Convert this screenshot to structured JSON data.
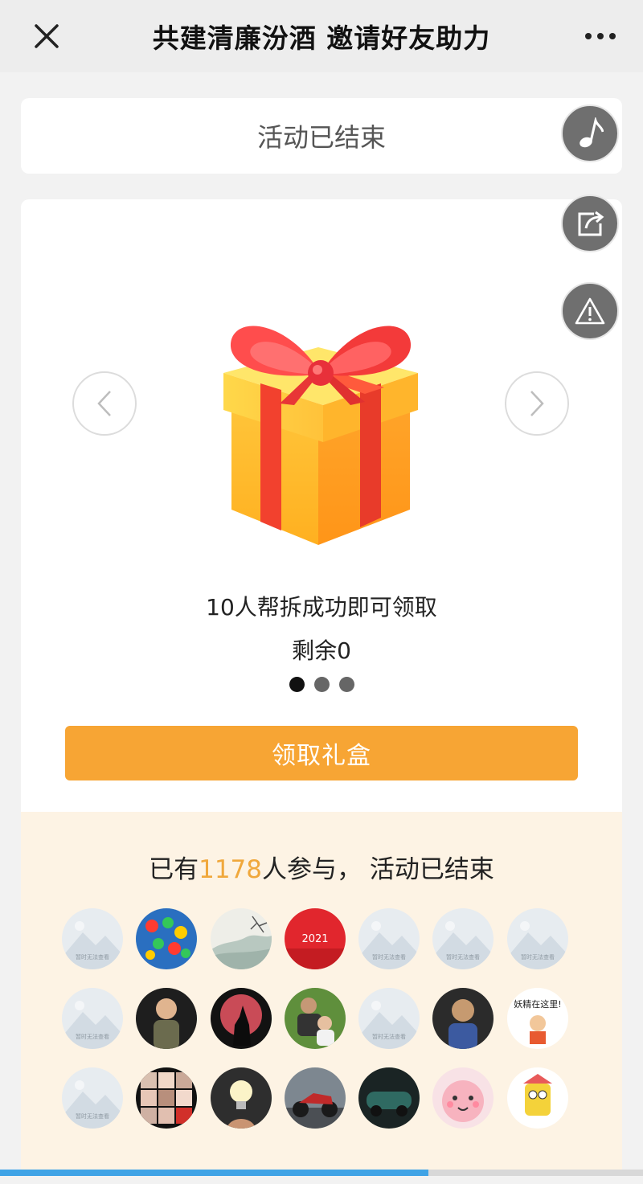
{
  "titlebar": {
    "title": "共建清廉汾酒 邀请好友助力",
    "close_icon": "close-icon",
    "more_icon": "more-icon"
  },
  "status": {
    "text": "活动已结束"
  },
  "gift": {
    "description": "10人帮拆成功即可领取",
    "remaining": "剩余0",
    "claim_label": "领取礼盒",
    "carousel_active_index": 0,
    "carousel_count": 3
  },
  "float_buttons": {
    "music_icon": "music-note-icon",
    "share_icon": "share-icon",
    "report_icon": "warning-icon"
  },
  "participants": {
    "prefix": "已有",
    "count": "1178",
    "suffix": "人参与，",
    "status": "活动已结束",
    "placeholder_text": "暂时无法查看",
    "avatars": [
      {
        "type": "placeholder"
      },
      {
        "type": "photo",
        "label": "candy"
      },
      {
        "type": "photo",
        "label": "landscape-painting"
      },
      {
        "type": "photo",
        "label": "2021"
      },
      {
        "type": "placeholder"
      },
      {
        "type": "placeholder"
      },
      {
        "type": "placeholder"
      },
      {
        "type": "placeholder"
      },
      {
        "type": "photo",
        "label": "child"
      },
      {
        "type": "photo",
        "label": "wolf-moon"
      },
      {
        "type": "photo",
        "label": "father-child"
      },
      {
        "type": "placeholder"
      },
      {
        "type": "photo",
        "label": "boy"
      },
      {
        "type": "photo",
        "label": "妖精在这里!"
      },
      {
        "type": "placeholder"
      },
      {
        "type": "photo",
        "label": "photo-collage"
      },
      {
        "type": "photo",
        "label": "lightbulb"
      },
      {
        "type": "photo",
        "label": "motorcycle"
      },
      {
        "type": "photo",
        "label": "car"
      },
      {
        "type": "photo",
        "label": "pink-cartoon"
      },
      {
        "type": "photo",
        "label": "cartoon-character"
      }
    ]
  },
  "loading_progress": 0.666,
  "colors": {
    "accent": "#f7a534",
    "count_highlight": "#f0a83c",
    "progress": "#3fa3e6",
    "participants_bg": "#fdf3e4"
  }
}
